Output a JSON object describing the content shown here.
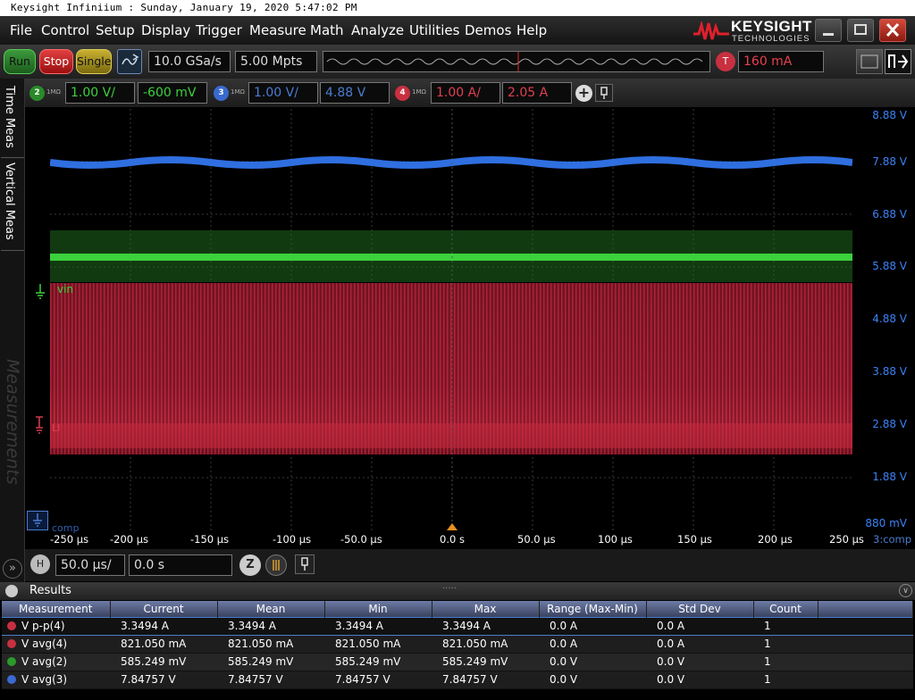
{
  "title_bar": "Keysight Infiniium : Sunday, January 19, 2020 5:47:02 PM",
  "menu": [
    "File",
    "Control",
    "Setup",
    "Display",
    "Trigger",
    "Measure",
    "Math",
    "Analyze",
    "Utilities",
    "Demos",
    "Help"
  ],
  "logo": {
    "brand": "KEYSIGHT",
    "sub": "TECHNOLOGIES"
  },
  "toolbar": {
    "run": "Run",
    "stop": "Stop",
    "single": "Single",
    "sample_rate": "10.0 GSa/s",
    "memory": "5.00 Mpts",
    "trigger_label": "T",
    "trigger_level": "160 mA"
  },
  "channels": [
    {
      "num": "2",
      "imp": "1MΩ",
      "scale": "1.00 V/",
      "offset": "-600 mV",
      "color": "#3dd13d"
    },
    {
      "num": "3",
      "imp": "1MΩ",
      "scale": "1.00 V/",
      "offset": "4.88 V",
      "color": "#4a7dd1"
    },
    {
      "num": "4",
      "imp": "1MΩ",
      "scale": "1.00 A/",
      "offset": "2.05 A",
      "color": "#d13a4a"
    }
  ],
  "side_tabs": [
    "Time Meas",
    "Vertical Meas"
  ],
  "watermark": "Measurements",
  "y_ticks": [
    "8.88 V",
    "7.88 V",
    "6.88 V",
    "5.88 V",
    "4.88 V",
    "3.88 V",
    "2.88 V",
    "1.88 V",
    "880 mV"
  ],
  "x_ticks": [
    "-250 µs",
    "-200 µs",
    "-150 µs",
    "-100 µs",
    "-50.0 µs",
    "0.0 s",
    "50.0 µs",
    "100 µs",
    "150 µs",
    "200 µs",
    "250 µs"
  ],
  "ref_label": "3:comp",
  "markers": {
    "vin": "vin",
    "li": "LI",
    "comp": "comp"
  },
  "horizontal": {
    "label": "H",
    "scale": "50.0 µs/",
    "position": "0.0 s"
  },
  "results": {
    "title": "Results",
    "columns": [
      "Measurement",
      "Current",
      "Mean",
      "Min",
      "Max",
      "Range (Max-Min)",
      "Std Dev",
      "Count"
    ],
    "rows": [
      {
        "ch": "4",
        "color": "#d13a4a",
        "cells": [
          "V p-p(4)",
          "3.3494 A",
          "3.3494 A",
          "3.3494 A",
          "3.3494 A",
          "0.0 A",
          "0.0 A",
          "1"
        ]
      },
      {
        "ch": "4",
        "color": "#d13a4a",
        "cells": [
          "V avg(4)",
          "821.050 mA",
          "821.050 mA",
          "821.050 mA",
          "821.050 mA",
          "0.0 A",
          "0.0 A",
          "1"
        ]
      },
      {
        "ch": "2",
        "color": "#3dd13d",
        "cells": [
          "V avg(2)",
          "585.249 mV",
          "585.249 mV",
          "585.249 mV",
          "585.249 mV",
          "0.0 V",
          "0.0 V",
          "1"
        ]
      },
      {
        "ch": "3",
        "color": "#4a7dd1",
        "cells": [
          "V avg(3)",
          "7.84757 V",
          "7.84757 V",
          "7.84757 V",
          "7.84757 V",
          "0.0 V",
          "0.0 V",
          "1"
        ]
      }
    ]
  },
  "colors": {
    "ch2": "#3dd13d",
    "ch3": "#4a7dd1",
    "ch4": "#c8283c",
    "grid": "#333333"
  }
}
